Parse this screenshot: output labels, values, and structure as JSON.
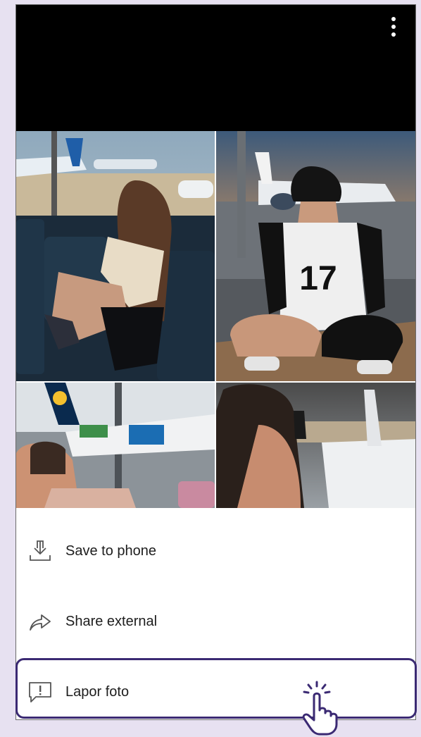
{
  "viewer": {
    "more_icon": "vertical-dots-icon"
  },
  "photos": [
    {
      "id_label": "airport-lounge-girl-sitting"
    },
    {
      "id_label": "airport-window-girl-number-17"
    },
    {
      "id_label": "airport-selfie-girl-lufthansa"
    },
    {
      "id_label": "airport-window-silhouette"
    }
  ],
  "menu": {
    "items": [
      {
        "label": "Save to phone",
        "icon": "download-icon"
      },
      {
        "label": "Share external",
        "icon": "share-arrow-icon"
      },
      {
        "label": "Lapor foto",
        "icon": "report-flag-icon"
      }
    ]
  },
  "colors": {
    "background": "#e7e1f1",
    "highlight": "#3b2a73",
    "text": "#1d1d1d"
  }
}
